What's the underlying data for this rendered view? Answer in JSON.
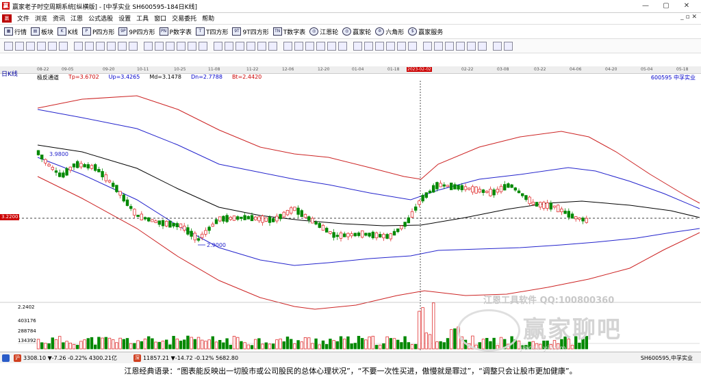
{
  "titlebar": {
    "icon": "赢",
    "title": "赢家老子时空周期系统[纵横版] - [中孚实业  SH600595-184日K线]",
    "min": "—",
    "max": "▢",
    "close": "✕"
  },
  "menubar": {
    "logo": "赢",
    "items": [
      "文件",
      "浏览",
      "资讯",
      "江恩",
      "公式选股",
      "设置",
      "工具",
      "窗口",
      "交易委托",
      "帮助"
    ],
    "right": "_ ▫ ✕"
  },
  "toolbar1": [
    {
      "icon": "grid-icon",
      "label": "行情"
    },
    {
      "icon": "blocks-icon",
      "label": "板块"
    },
    {
      "icon": "k-icon",
      "label": "K线"
    },
    {
      "icon": "p-icon",
      "label": "P四方形"
    },
    {
      "icon": "9p-icon",
      "label": "9P四方形"
    },
    {
      "icon": "pn-icon",
      "label": "P数字表"
    },
    {
      "icon": "t-icon",
      "label": "T四方形"
    },
    {
      "icon": "9t-icon",
      "label": "9T四方形"
    },
    {
      "icon": "tn-icon",
      "label": "T数字表"
    },
    {
      "icon": "wheel-icon",
      "label": "江恩轮"
    },
    {
      "icon": "wheel-icon",
      "label": "赢家轮"
    },
    {
      "icon": "star-icon",
      "label": "六角形"
    },
    {
      "icon": "dollar-icon",
      "label": "赢家服务"
    }
  ],
  "period": "日K线",
  "dates": [
    {
      "label": "08-22",
      "hl": false
    },
    {
      "label": "09-05",
      "hl": false
    },
    {
      "label": "09-20",
      "hl": false
    },
    {
      "label": "10-11",
      "hl": false
    },
    {
      "label": "10-25",
      "hl": false
    },
    {
      "label": "11-08",
      "hl": false
    },
    {
      "label": "11-22",
      "hl": false
    },
    {
      "label": "12-06",
      "hl": false
    },
    {
      "label": "12-20",
      "hl": false
    },
    {
      "label": "01-04",
      "hl": false
    },
    {
      "label": "01-18",
      "hl": false
    },
    {
      "label": "2023-02-02",
      "hl": true
    },
    {
      "label": "02-22",
      "hl": false
    },
    {
      "label": "03-08",
      "hl": false
    },
    {
      "label": "03-22",
      "hl": false
    },
    {
      "label": "04-06",
      "hl": false
    },
    {
      "label": "04-20",
      "hl": false
    },
    {
      "label": "05-04",
      "hl": false
    },
    {
      "label": "05-18",
      "hl": false
    }
  ],
  "indicator": {
    "name": "极反通道",
    "tp": "Tp=3.6702",
    "up": "Up=3.4265",
    "md": "Md=3.1478",
    "dn": "Dn=2.7788",
    "bt": "Bt=2.4420"
  },
  "stock_code": "600595 中孚实业",
  "price_tag": "3.2200",
  "annotations": {
    "high": "3.9800",
    "low": "2.9000"
  },
  "volume_axis": {
    "top": "2.2402",
    "v1": "403176",
    "v2": "288784",
    "v3": "134392"
  },
  "watermark": {
    "line1": "江恩工具软件  QQ:100800360",
    "logo": "赢家聊吧",
    "line3": "jiaoba.yi.com"
  },
  "statusbar": {
    "sh_label": "沪",
    "sh_text": "3308.10  ▼-7.26  -0.22%  4300.21亿",
    "sz_label": "深",
    "sz_text": "11857.21  ▼-14.72  -0.12%  5682.80",
    "code": "SH600595,中孚实业"
  },
  "footer": "江恩经典语录：“图表能反映出一切股市或公司股民的总体心理状况”，“不要一次性买进，傲慢就是罪过”，“调整只会让股市更加健康”。",
  "colors": {
    "up": "#e03030",
    "down": "#008800",
    "band_outer": "#cc2222",
    "band_inner": "#2222cc",
    "mid": "#000000"
  }
}
